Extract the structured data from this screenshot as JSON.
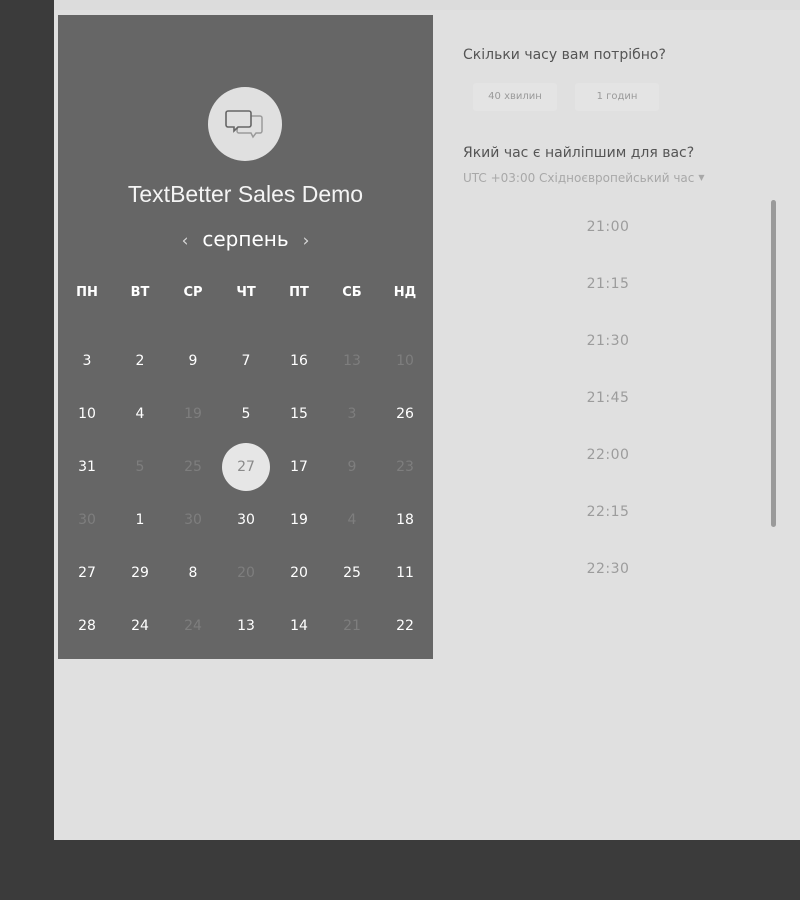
{
  "event": {
    "title": "TextBetter Sales Demo",
    "icon": "chat-bubbles-icon"
  },
  "calendar": {
    "month": "серпень",
    "prev_arrow": "‹",
    "next_arrow": "›",
    "weekdays": [
      "ПН",
      "ВТ",
      "СР",
      "ЧТ",
      "ПТ",
      "СБ",
      "НД"
    ],
    "rows": [
      [
        {
          "d": "3",
          "dim": false
        },
        {
          "d": "2",
          "dim": false
        },
        {
          "d": "9",
          "dim": false
        },
        {
          "d": "7",
          "dim": false
        },
        {
          "d": "16",
          "dim": false
        },
        {
          "d": "13",
          "dim": true
        },
        {
          "d": "10",
          "dim": true
        }
      ],
      [
        {
          "d": "10",
          "dim": false
        },
        {
          "d": "4",
          "dim": false
        },
        {
          "d": "19",
          "dim": true
        },
        {
          "d": "5",
          "dim": false
        },
        {
          "d": "15",
          "dim": false
        },
        {
          "d": "3",
          "dim": true
        },
        {
          "d": "26",
          "dim": false
        }
      ],
      [
        {
          "d": "31",
          "dim": false
        },
        {
          "d": "5",
          "dim": true
        },
        {
          "d": "25",
          "dim": true
        },
        {
          "d": "27",
          "dim": false,
          "selected": true
        },
        {
          "d": "17",
          "dim": false
        },
        {
          "d": "9",
          "dim": true
        },
        {
          "d": "23",
          "dim": true
        }
      ],
      [
        {
          "d": "30",
          "dim": true
        },
        {
          "d": "1",
          "dim": false
        },
        {
          "d": "30",
          "dim": true
        },
        {
          "d": "30",
          "dim": false
        },
        {
          "d": "19",
          "dim": false
        },
        {
          "d": "4",
          "dim": true
        },
        {
          "d": "18",
          "dim": false
        }
      ],
      [
        {
          "d": "27",
          "dim": false
        },
        {
          "d": "29",
          "dim": false
        },
        {
          "d": "8",
          "dim": false
        },
        {
          "d": "20",
          "dim": true
        },
        {
          "d": "20",
          "dim": false
        },
        {
          "d": "25",
          "dim": false
        },
        {
          "d": "11",
          "dim": false
        }
      ],
      [
        {
          "d": "28",
          "dim": false
        },
        {
          "d": "24",
          "dim": false
        },
        {
          "d": "24",
          "dim": true
        },
        {
          "d": "13",
          "dim": false
        },
        {
          "d": "14",
          "dim": false
        },
        {
          "d": "21",
          "dim": true
        },
        {
          "d": "22",
          "dim": false
        }
      ]
    ]
  },
  "duration": {
    "heading": "Скільки часу вам потрібно?",
    "options": [
      "40 хвилин",
      "1 годин"
    ]
  },
  "time": {
    "heading": "Який час є найліпшим для вас?",
    "timezone": "UTC +03:00 Східноєвропейський час",
    "slots": [
      "21:00",
      "21:15",
      "21:30",
      "21:45",
      "22:00",
      "22:15",
      "22:30"
    ]
  },
  "colors": {
    "panel": "#666666",
    "page": "#e0e0e0",
    "background": "#3b3b3b"
  }
}
